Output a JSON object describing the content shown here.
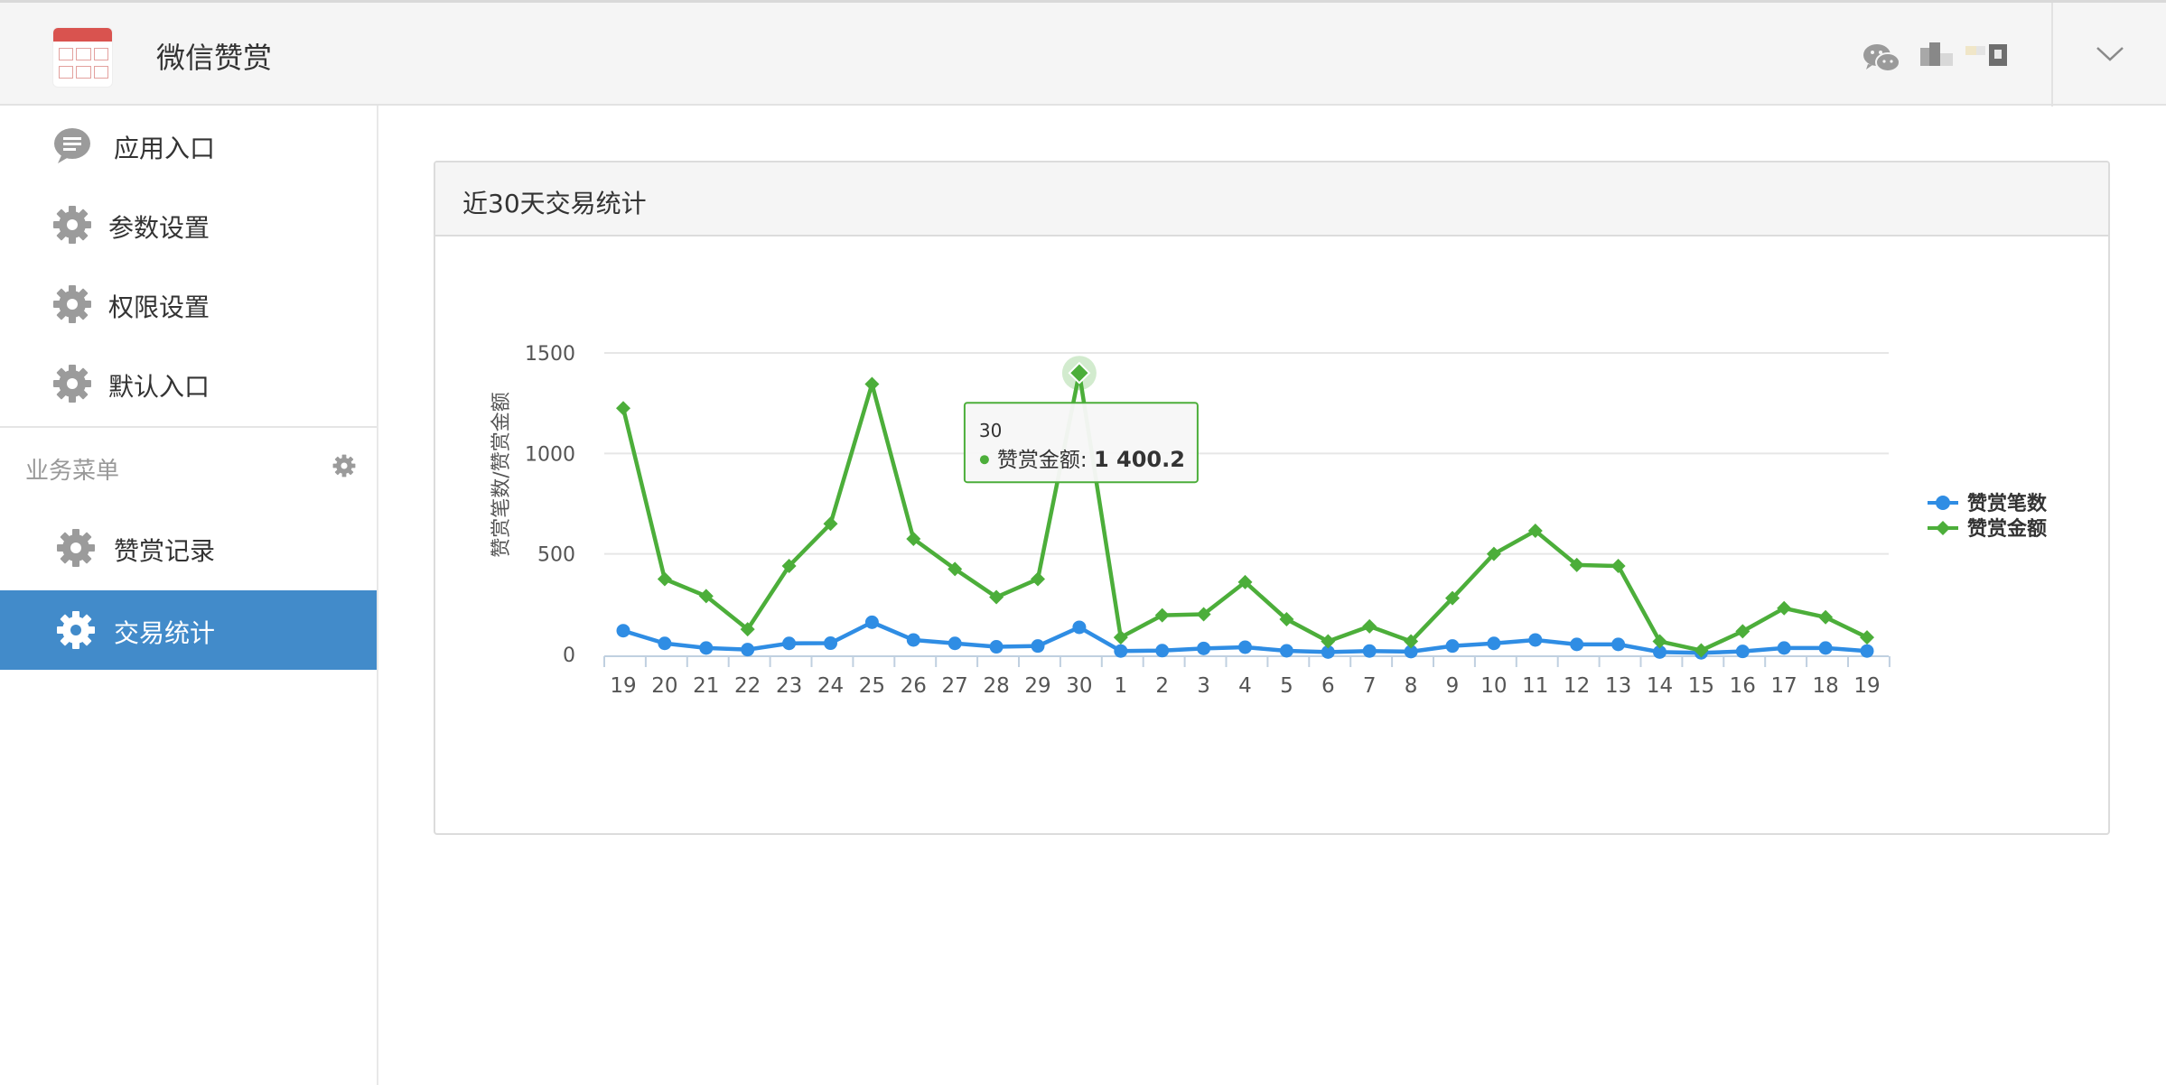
{
  "app": {
    "title": "微信赞赏"
  },
  "colors": {
    "sidebar_active": "#428bca",
    "series_count": "#2f8de4",
    "series_amount": "#4cae3a"
  },
  "sidebar": {
    "items": [
      {
        "label": "应用入口",
        "icon": "chat-bubble-icon"
      },
      {
        "label": "参数设置",
        "icon": "gear-icon"
      },
      {
        "label": "权限设置",
        "icon": "gear-icon"
      },
      {
        "label": "默认入口",
        "icon": "gear-icon"
      }
    ],
    "section_title": "业务菜单",
    "section_items": [
      {
        "label": "赞赏记录",
        "icon": "gear-icon",
        "active": false
      },
      {
        "label": "交易统计",
        "icon": "gear-icon",
        "active": true
      }
    ]
  },
  "panel": {
    "title": "近30天交易统计"
  },
  "chart_data": {
    "type": "line",
    "ylabel": "赞赏笔数/赞赏金额",
    "ylim": [
      0,
      1500
    ],
    "yticks": [
      "0",
      "500",
      "1000",
      "1500"
    ],
    "grid": true,
    "legend_position": "right",
    "categories": [
      "19",
      "20",
      "21",
      "22",
      "23",
      "24",
      "25",
      "26",
      "27",
      "28",
      "29",
      "30",
      "1",
      "2",
      "3",
      "4",
      "5",
      "6",
      "7",
      "8",
      "9",
      "10",
      "11",
      "12",
      "13",
      "14",
      "15",
      "16",
      "17",
      "18",
      "19"
    ],
    "series": [
      {
        "name": "赞赏笔数",
        "marker": "circle",
        "values": [
          118,
          55,
          32,
          24,
          55,
          56,
          160,
          72,
          55,
          38,
          42,
          135,
          17,
          19,
          30,
          36,
          18,
          12,
          17,
          14,
          42,
          55,
          72,
          50,
          50,
          12,
          8,
          15,
          32,
          32,
          17
        ]
      },
      {
        "name": "赞赏金额",
        "marker": "diamond",
        "values": [
          1225,
          375,
          290,
          125,
          440,
          650,
          1345,
          575,
          425,
          285,
          375,
          1400.2,
          85,
          195,
          200,
          360,
          175,
          65,
          140,
          65,
          280,
          500,
          615,
          445,
          440,
          65,
          20,
          115,
          230,
          185,
          85
        ]
      }
    ],
    "tooltip": {
      "category": "30",
      "series": "赞赏金额",
      "label": "赞赏金额: ",
      "value": "1 400.2"
    }
  }
}
